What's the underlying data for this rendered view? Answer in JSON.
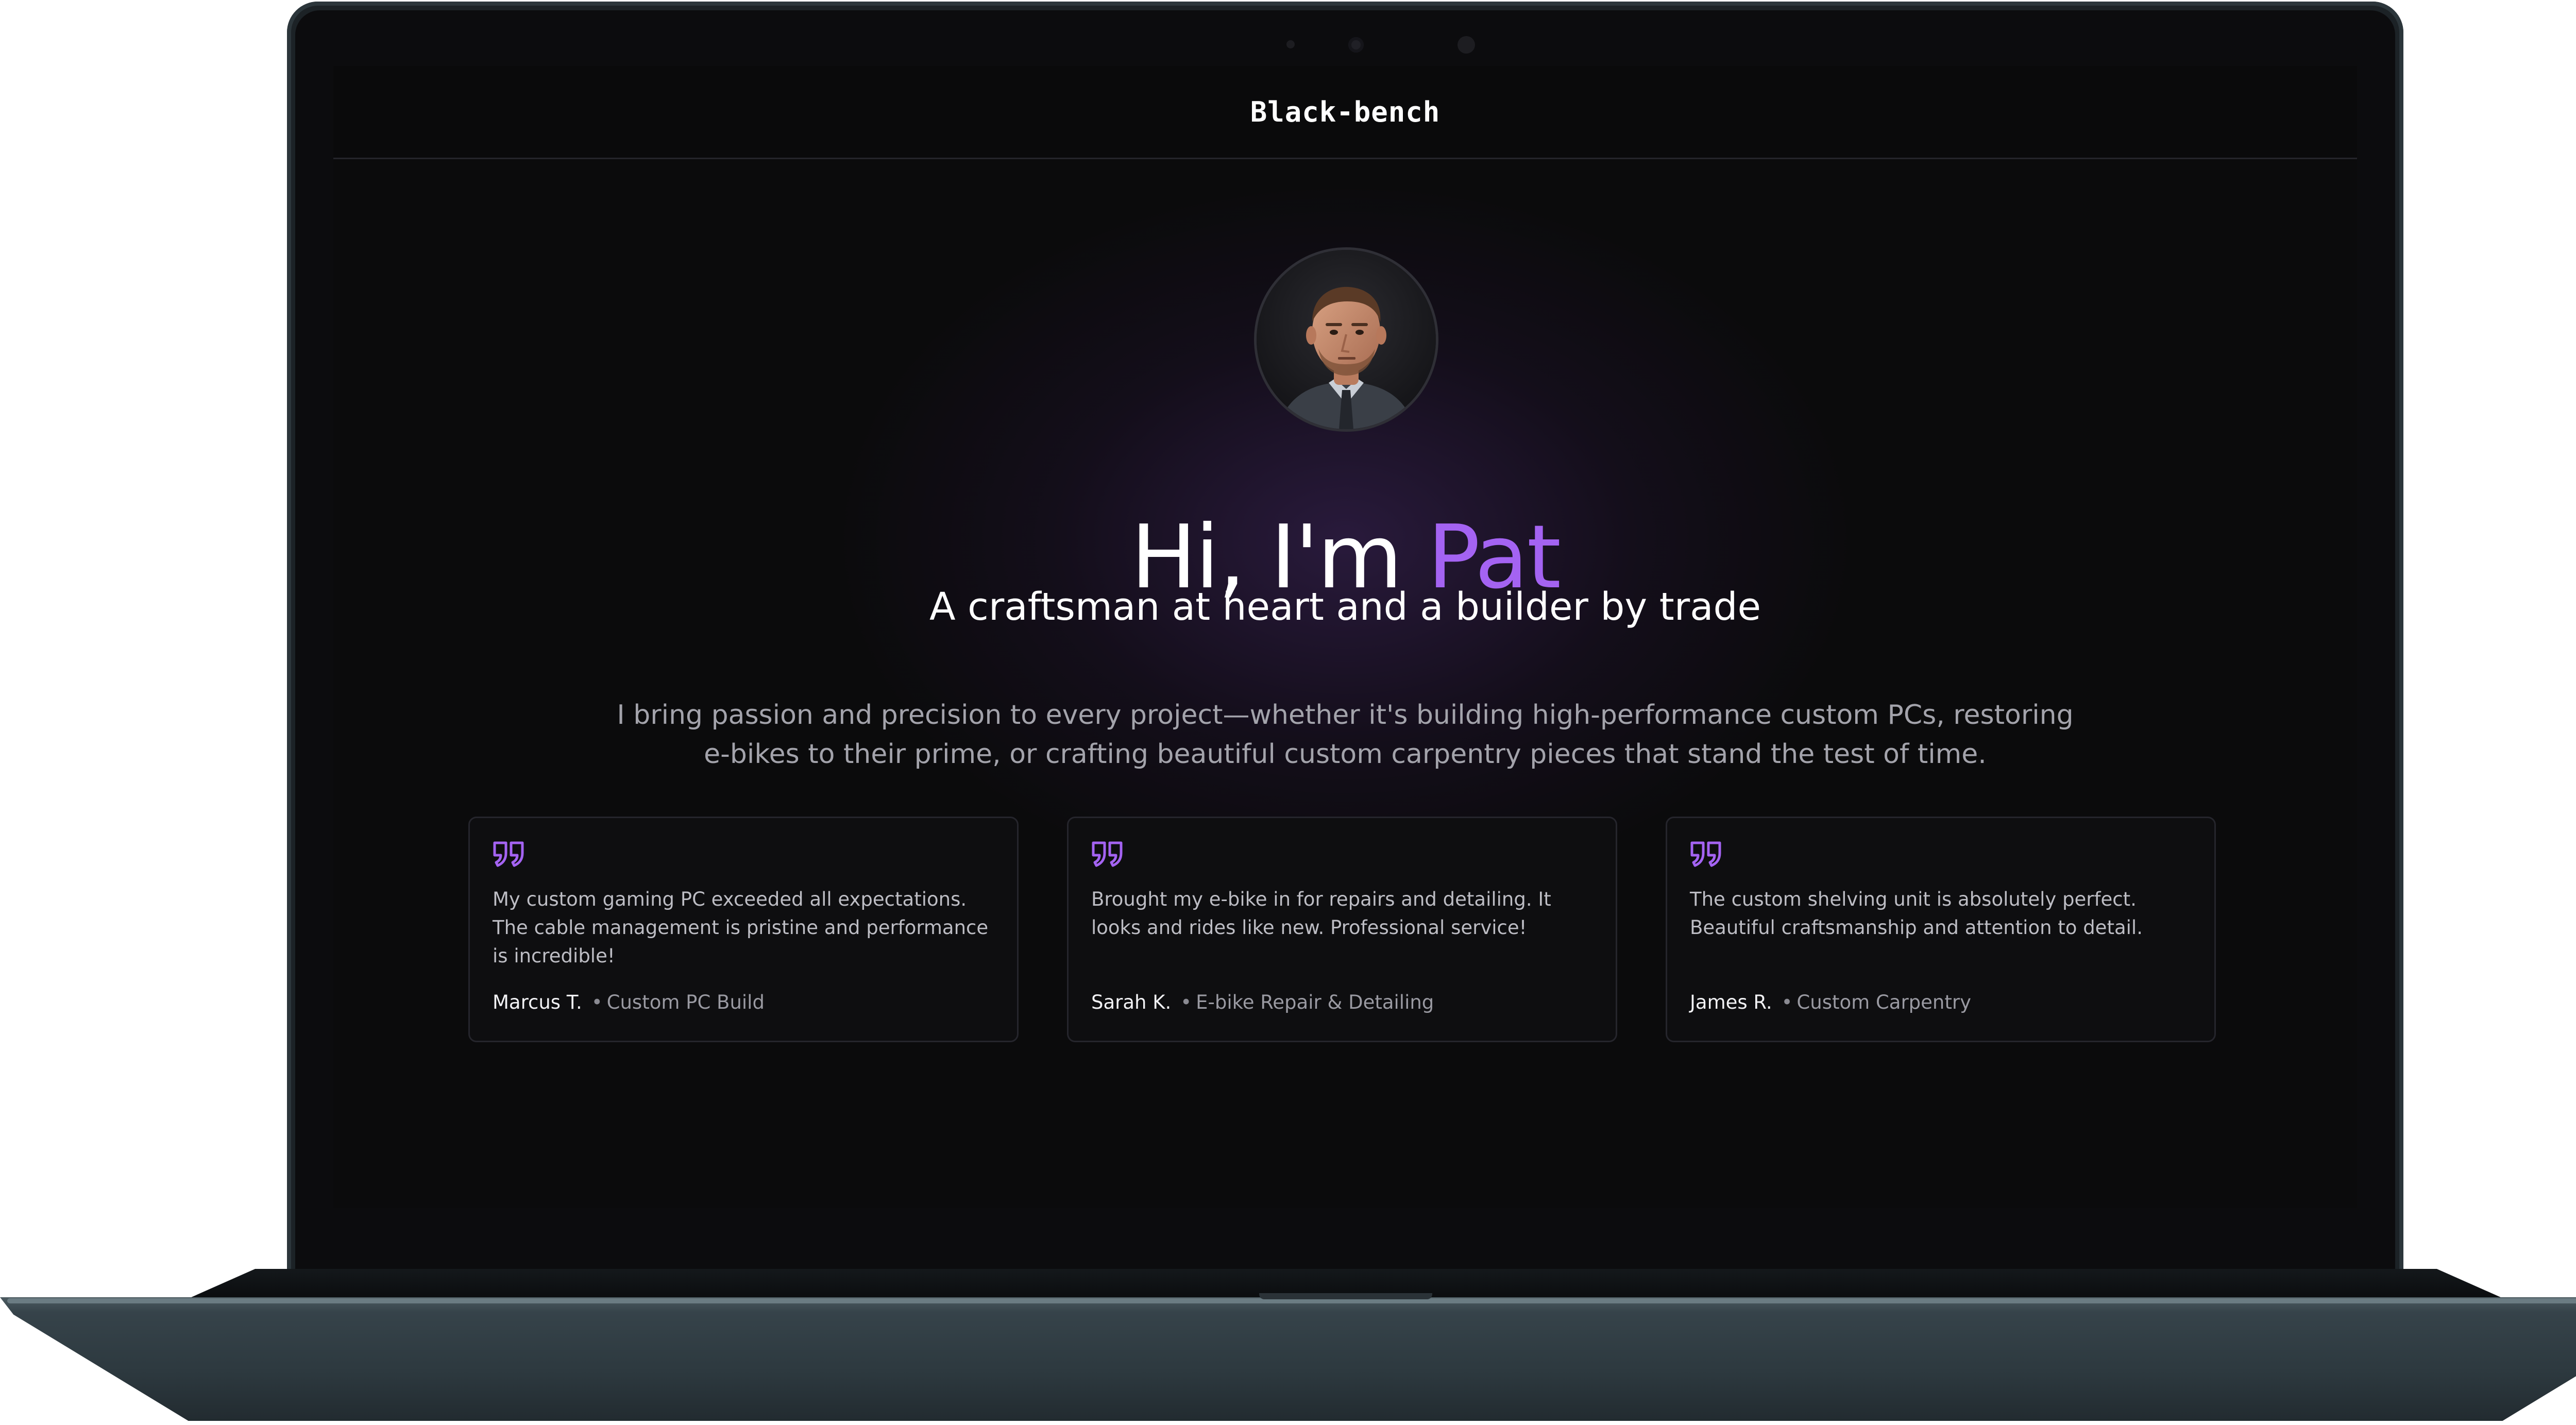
{
  "site": {
    "brand": "Black-bench"
  },
  "hero": {
    "greeting": "Hi, I'm",
    "name": "Pat",
    "subtitle": "A craftsman at heart and a builder by trade",
    "intro": "I bring passion and precision to every project—whether it's building high-performance custom PCs, restoring e-bikes to their prime, or crafting beautiful custom carpentry pieces that stand the test of time.",
    "avatar_icon": "profile-photo"
  },
  "testimonials": [
    {
      "quote": "My custom gaming PC exceeded all expectations. The cable management is pristine and performance is incredible!",
      "author": "Marcus T.",
      "service": "Custom PC Build"
    },
    {
      "quote": "Brought my e-bike in for repairs and detailing. It looks and rides like new. Professional service!",
      "author": "Sarah K.",
      "service": "E-bike Repair & Detailing"
    },
    {
      "quote": "The custom shelving unit is absolutely perfect. Beautiful craftsmanship and attention to detail.",
      "author": "James R.",
      "service": "Custom Carpentry"
    }
  ],
  "theme": {
    "background": "#0b0b0c",
    "accent": "#a463f2",
    "text": "#ffffff",
    "muted": "#a3a3ab",
    "card_border": "#25252c",
    "laptop_body": "#36434a"
  },
  "icons": {
    "quote": "quote-icon"
  }
}
